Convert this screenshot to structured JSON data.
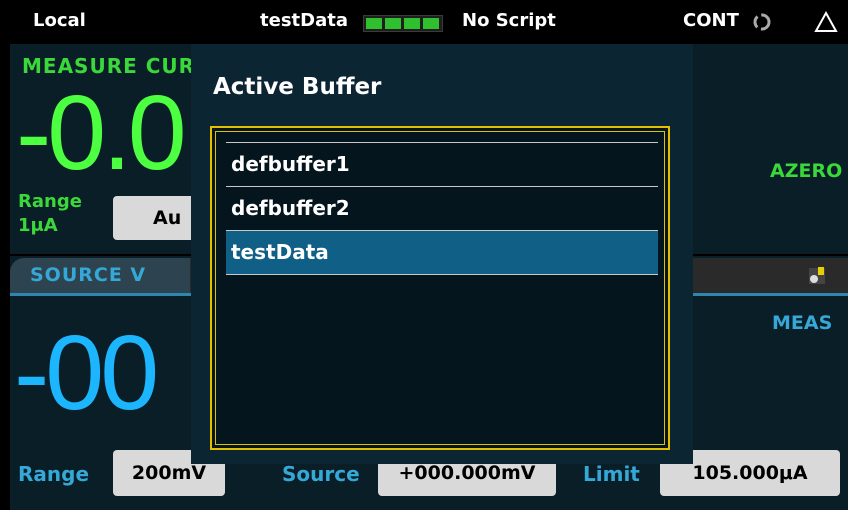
{
  "status_bar": {
    "mode": "Local",
    "buffer_name": "testData",
    "buffer_fill_fraction": 0.85,
    "script": "No Script",
    "trigger": "CONT",
    "alert_icon": "warning-triangle-icon"
  },
  "measure": {
    "title": "MEASURE CUR",
    "value": "-0.0",
    "range_label": "Range",
    "range_value": "1μA",
    "range_button": "Au",
    "azero": "AZERO"
  },
  "source": {
    "title": "SOURCE V",
    "value": "-00",
    "meas_label": "MEAS",
    "range_label": "Range",
    "range_button": "200mV",
    "source_label": "Source",
    "source_button": "+000.000mV",
    "limit_label": "Limit",
    "limit_button": "105.000μA"
  },
  "dialog": {
    "title": "Active Buffer",
    "items": [
      {
        "label": "defbuffer1",
        "selected": false
      },
      {
        "label": "defbuffer2",
        "selected": false
      },
      {
        "label": "testData",
        "selected": true
      }
    ]
  },
  "colors": {
    "measure_green": "#4cff40",
    "source_blue": "#1cb6ff",
    "selection": "#0f5f86",
    "dialog_border": "#e6c000"
  }
}
